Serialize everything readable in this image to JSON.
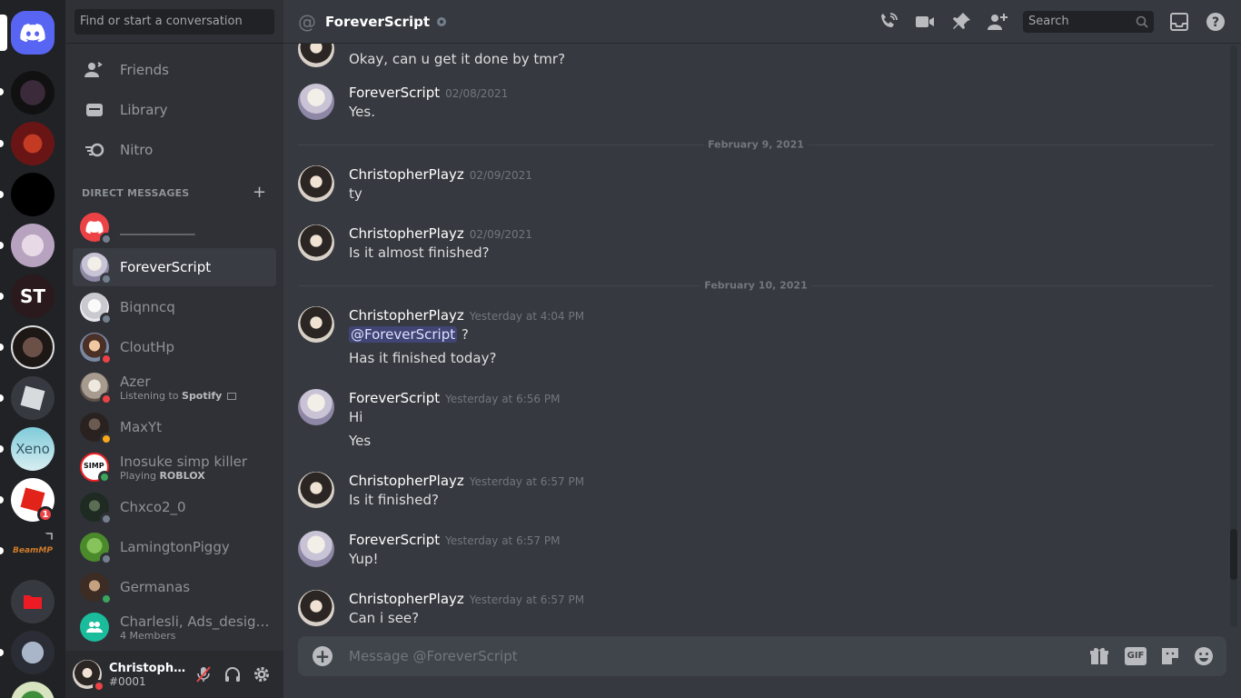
{
  "sidebar": {
    "search_placeholder": "Find or start a conversation",
    "nav": [
      "Friends",
      "Library",
      "Nitro"
    ],
    "dm_header": "DIRECT MESSAGES",
    "dms": [
      {
        "name": "___________",
        "sub": "",
        "status": "off"
      },
      {
        "name": "ForeverScript",
        "sub": "",
        "status": "off"
      },
      {
        "name": "Biqnncq",
        "sub": "",
        "status": "off"
      },
      {
        "name": "CloutHp",
        "sub": "",
        "status": "dnd"
      },
      {
        "name": "Azer",
        "sub_prefix": "Listening to ",
        "sub_bold": "Spotify",
        "status": "dnd"
      },
      {
        "name": "MaxYt",
        "sub": "",
        "status": "idle"
      },
      {
        "name": "Inosuke simp killer",
        "sub_prefix": "Playing ",
        "sub_bold": "ROBLOX",
        "status": "onl"
      },
      {
        "name": "Chxco2_0",
        "sub": "",
        "status": "off"
      },
      {
        "name": "LamingtonPiggy",
        "sub": "",
        "status": "off"
      },
      {
        "name": "Germanas",
        "sub": "",
        "status": "onl"
      },
      {
        "name": "Charlesli, Ads_design...",
        "sub": "4 Members",
        "status": ""
      }
    ]
  },
  "user": {
    "name": "Christopher...",
    "tag": "#0001"
  },
  "rail": {
    "badge": "1"
  },
  "header": {
    "title": "ForeverScript",
    "search_placeholder": "Search"
  },
  "messages": {
    "m0": {
      "text": "Okay, can u get it done by tmr?"
    },
    "m1": {
      "author": "ForeverScript",
      "time": "02/08/2021",
      "text": "Yes."
    },
    "d1": "February 9, 2021",
    "m2": {
      "author": "ChristopherPlayz",
      "time": "02/09/2021",
      "text": "ty"
    },
    "m3": {
      "author": "ChristopherPlayz",
      "time": "02/09/2021",
      "text": "Is it almost finished?"
    },
    "d2": "February 10, 2021",
    "m4": {
      "author": "ChristopherPlayz",
      "time": "Yesterday at 4:04 PM",
      "mention": "@ForeverScript",
      "text1": " ?",
      "text2": "Has it finished today?"
    },
    "m5": {
      "author": "ForeverScript",
      "time": "Yesterday at 6:56 PM",
      "text1": "Hi",
      "text2": "Yes"
    },
    "m6": {
      "author": "ChristopherPlayz",
      "time": "Yesterday at 6:57 PM",
      "text": "Is it finished?"
    },
    "m7": {
      "author": "ForeverScript",
      "time": "Yesterday at 6:57 PM",
      "text": "Yup!"
    },
    "m8": {
      "author": "ChristopherPlayz",
      "time": "Yesterday at 6:57 PM",
      "text": "Can i see?"
    }
  },
  "composer": {
    "placeholder": "Message @ForeverScript",
    "gif_label": "GIF"
  },
  "colors": {
    "accent": "#5865f2",
    "background": "#36393f",
    "sidebar": "#2f3136",
    "rail": "#202225"
  }
}
